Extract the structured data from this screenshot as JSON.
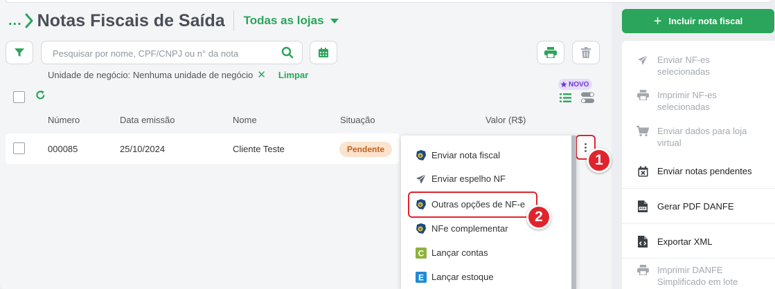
{
  "header": {
    "breadcrumb_ellipsis": "...",
    "title": "Notas Fiscais de Saída",
    "store_selector": "Todas as lojas"
  },
  "toolbar": {
    "search_placeholder": "Pesquisar por nome, CPF/CNPJ ou n° da nota"
  },
  "filter": {
    "text": "Unidade de negócio: Nenhuma unidade de negócio",
    "remove": "✕",
    "clear_label": "Limpar"
  },
  "view": {
    "new_badge": "NOVO"
  },
  "table": {
    "columns": [
      "Número",
      "Data emissão",
      "Nome",
      "Situação",
      "Valor (R$)"
    ],
    "rows": [
      {
        "numero": "000085",
        "data": "25/10/2024",
        "nome": "Cliente Teste",
        "situacao": "Pendente"
      }
    ]
  },
  "row_menu": {
    "items": [
      {
        "label": "Enviar nota fiscal",
        "icon": "nfe-brazil-icon"
      },
      {
        "label": "Enviar espelho NF",
        "icon": "send-plane-icon"
      },
      {
        "label": "Outras opções de NF-e",
        "icon": "nfe-brazil-icon"
      },
      {
        "label": "NFe complementar",
        "icon": "nfe-brazil-icon"
      },
      {
        "label": "Lançar contas",
        "icon": "c-square-icon"
      },
      {
        "label": "Lançar estoque",
        "icon": "e-square-icon"
      }
    ]
  },
  "annotations": {
    "marker1": "1",
    "marker2": "2"
  },
  "sidebar": {
    "add_button": "Incluir nota fiscal",
    "items": [
      {
        "label": "Enviar NF-es selecionadas",
        "icon": "send-plane-icon",
        "enabled": false
      },
      {
        "label": "Imprimir NF-es selecionadas",
        "icon": "printer-icon",
        "enabled": false
      },
      {
        "label": "Enviar dados para loja virtual",
        "icon": "cart-icon",
        "enabled": false
      },
      {
        "label": "Enviar notas pendentes",
        "icon": "calendar-x-icon",
        "enabled": true
      },
      {
        "label": "Gerar PDF DANFE",
        "icon": "pdf-file-icon",
        "enabled": true
      },
      {
        "label": "Exportar XML",
        "icon": "code-file-icon",
        "enabled": true
      },
      {
        "label": "Imprimir DANFE Simplificado em lote",
        "icon": "printer-icon",
        "enabled": false
      }
    ]
  },
  "colors": {
    "brand_green": "#2aa55b",
    "highlight_red": "#e0242c",
    "badge_bg": "#fbe3cd",
    "badge_text": "#c3621c",
    "new_badge_bg": "#e7dcfb",
    "new_badge_text": "#6c3bd1"
  }
}
